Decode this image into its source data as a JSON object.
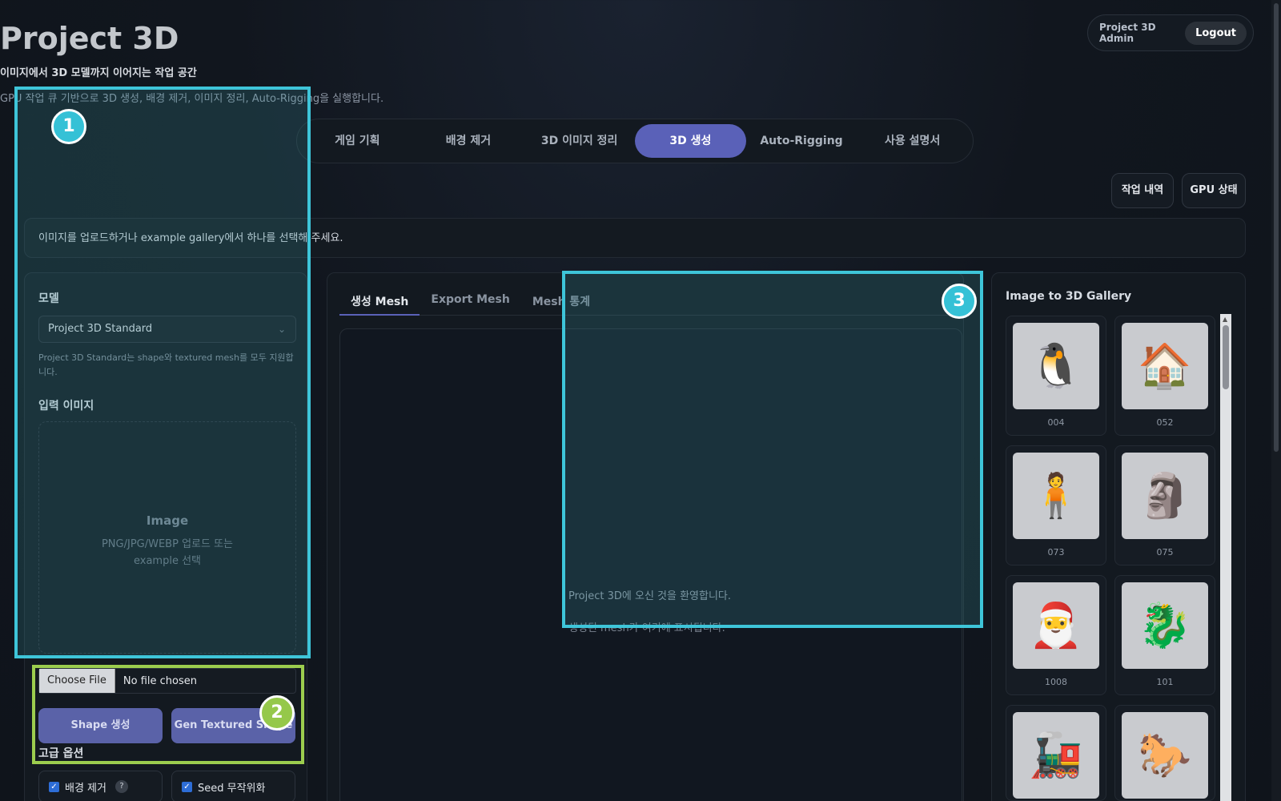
{
  "header": {
    "title": "Project 3D",
    "subtitle": "이미지에서 3D 모델까지 이어지는 작업 공간",
    "description": "GPU 작업 큐 기반으로 3D 생성, 배경 제거, 이미지 정리, Auto-Rigging을 실행합니다."
  },
  "user": {
    "name": "Project 3D Admin",
    "logout_label": "Logout"
  },
  "nav_tabs": [
    {
      "label": "게임 기획"
    },
    {
      "label": "배경 제거"
    },
    {
      "label": "3D 이미지 정리"
    },
    {
      "label": "3D 생성",
      "active": true
    },
    {
      "label": "Auto-Rigging"
    },
    {
      "label": "사용 설명서"
    }
  ],
  "actions": {
    "history_label": "작업 내역",
    "gpu_label": "GPU 상태"
  },
  "notice": "이미지를 업로드하거나 example gallery에서 하나를 선택해 주세요.",
  "left_panel": {
    "model_label": "모델",
    "model_value": "Project 3D Standard",
    "model_hint": "Project 3D Standard는 shape와 textured mesh를 모두 지원합니다.",
    "input_label": "입력 이미지",
    "dropzone_title": "Image",
    "dropzone_sub": "PNG/JPG/WEBP 업로드 또는 example 선택",
    "file_button": "Choose File",
    "file_status": "No file chosen",
    "shape_button": "Shape 생성",
    "textured_button": "Gen Textured Shape",
    "advanced_label": "고급 옵션",
    "remove_bg_label": "배경 제거",
    "seed_label": "Seed 무작위화",
    "help_glyph": "?"
  },
  "center_panel": {
    "tabs": [
      "생성 Mesh",
      "Export Mesh",
      "Mesh 통계"
    ],
    "welcome": "Project 3D에 오신 것을 환영합니다.",
    "welcome_sub": "생성된 mesh가 여기에 표시됩니다."
  },
  "gallery": {
    "title": "Image to 3D Gallery",
    "items": [
      {
        "label": "004",
        "icon": "🐧"
      },
      {
        "label": "052",
        "icon": "🏠"
      },
      {
        "label": "073",
        "icon": "🧍"
      },
      {
        "label": "075",
        "icon": "🗿"
      },
      {
        "label": "1008",
        "icon": "🎅"
      },
      {
        "label": "101",
        "icon": "🐉"
      },
      {
        "label": "",
        "icon": "🚂"
      },
      {
        "label": "",
        "icon": "🐎"
      }
    ]
  },
  "annotations": [
    "1",
    "2",
    "3"
  ],
  "colors": {
    "accent": "#5a61b8",
    "annotation_cyan": "#3ec5d9",
    "annotation_green": "#9ccd4e"
  }
}
